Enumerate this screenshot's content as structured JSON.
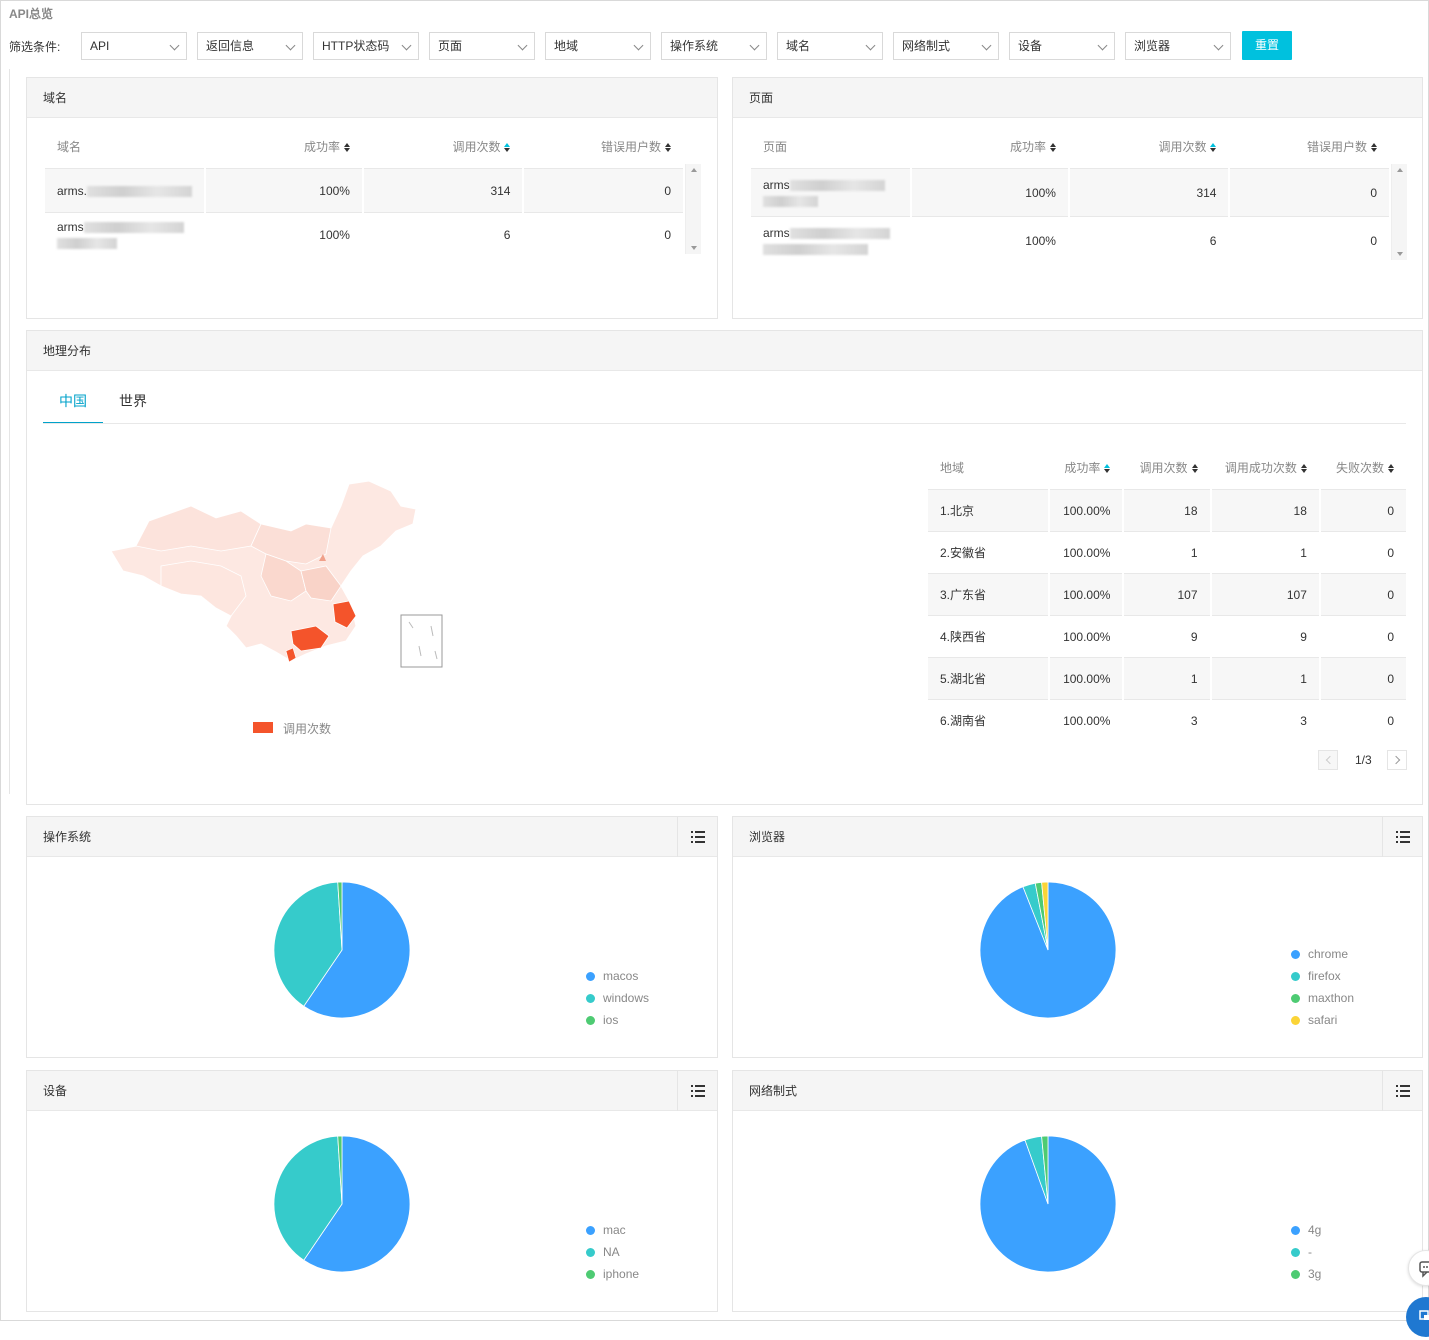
{
  "page_title": "API总览",
  "filter": {
    "label": "筛选条件:",
    "selects": [
      "API",
      "返回信息",
      "HTTP状态码",
      "页面",
      "地域",
      "操作系统",
      "域名",
      "网络制式",
      "设备",
      "浏览器"
    ],
    "reset_label": "重置"
  },
  "domain_panel": {
    "title": "域名",
    "columns": [
      "域名",
      "成功率",
      "调用次数",
      "错误用户数"
    ],
    "rows": [
      {
        "name": "arms.",
        "success_rate": "100%",
        "calls": "314",
        "error_users": "0"
      },
      {
        "name": "arms",
        "success_rate": "100%",
        "calls": "6",
        "error_users": "0"
      }
    ]
  },
  "page_panel": {
    "title": "页面",
    "columns": [
      "页面",
      "成功率",
      "调用次数",
      "错误用户数"
    ],
    "rows": [
      {
        "name": "arms",
        "success_rate": "100%",
        "calls": "314",
        "error_users": "0"
      },
      {
        "name": "arms",
        "success_rate": "100%",
        "calls": "6",
        "error_users": "0"
      }
    ]
  },
  "geo_panel": {
    "title": "地理分布",
    "tabs": [
      "中国",
      "世界"
    ],
    "active_tab": "中国",
    "map_legend": "调用次数",
    "map_color_high": "#f4542b",
    "map_color_low": "#fde8e2",
    "columns": [
      "地域",
      "成功率",
      "调用次数",
      "调用成功次数",
      "失败次数"
    ],
    "rows": [
      {
        "region": "1.北京",
        "success_rate": "100.00%",
        "calls": "18",
        "success_calls": "18",
        "failures": "0"
      },
      {
        "region": "2.安徽省",
        "success_rate": "100.00%",
        "calls": "1",
        "success_calls": "1",
        "failures": "0"
      },
      {
        "region": "3.广东省",
        "success_rate": "100.00%",
        "calls": "107",
        "success_calls": "107",
        "failures": "0"
      },
      {
        "region": "4.陕西省",
        "success_rate": "100.00%",
        "calls": "9",
        "success_calls": "9",
        "failures": "0"
      },
      {
        "region": "5.湖北省",
        "success_rate": "100.00%",
        "calls": "1",
        "success_calls": "1",
        "failures": "0"
      },
      {
        "region": "6.湖南省",
        "success_rate": "100.00%",
        "calls": "3",
        "success_calls": "3",
        "failures": "0"
      }
    ],
    "pagination": "1/3"
  },
  "pies": [
    {
      "title": "操作系统",
      "slices": [
        {
          "label": "macos",
          "fraction": 0.595,
          "color": "#3ba1ff"
        },
        {
          "label": "windows",
          "fraction": 0.395,
          "color": "#36cbcb"
        },
        {
          "label": "ios",
          "fraction": 0.01,
          "color": "#4ecb73"
        }
      ]
    },
    {
      "title": "浏览器",
      "slices": [
        {
          "label": "chrome",
          "fraction": 0.94,
          "color": "#3ba1ff"
        },
        {
          "label": "firefox",
          "fraction": 0.03,
          "color": "#36cbcb"
        },
        {
          "label": "maxthon",
          "fraction": 0.015,
          "color": "#4ecb73"
        },
        {
          "label": "safari",
          "fraction": 0.015,
          "color": "#fbd437"
        }
      ]
    },
    {
      "title": "设备",
      "slices": [
        {
          "label": "mac",
          "fraction": 0.595,
          "color": "#3ba1ff"
        },
        {
          "label": "NA",
          "fraction": 0.395,
          "color": "#36cbcb"
        },
        {
          "label": "iphone",
          "fraction": 0.01,
          "color": "#4ecb73"
        }
      ]
    },
    {
      "title": "网络制式",
      "slices": [
        {
          "label": "4g",
          "fraction": 0.945,
          "color": "#3ba1ff"
        },
        {
          "label": "-",
          "fraction": 0.04,
          "color": "#36cbcb"
        },
        {
          "label": "3g",
          "fraction": 0.015,
          "color": "#4ecb73"
        }
      ]
    }
  ]
}
